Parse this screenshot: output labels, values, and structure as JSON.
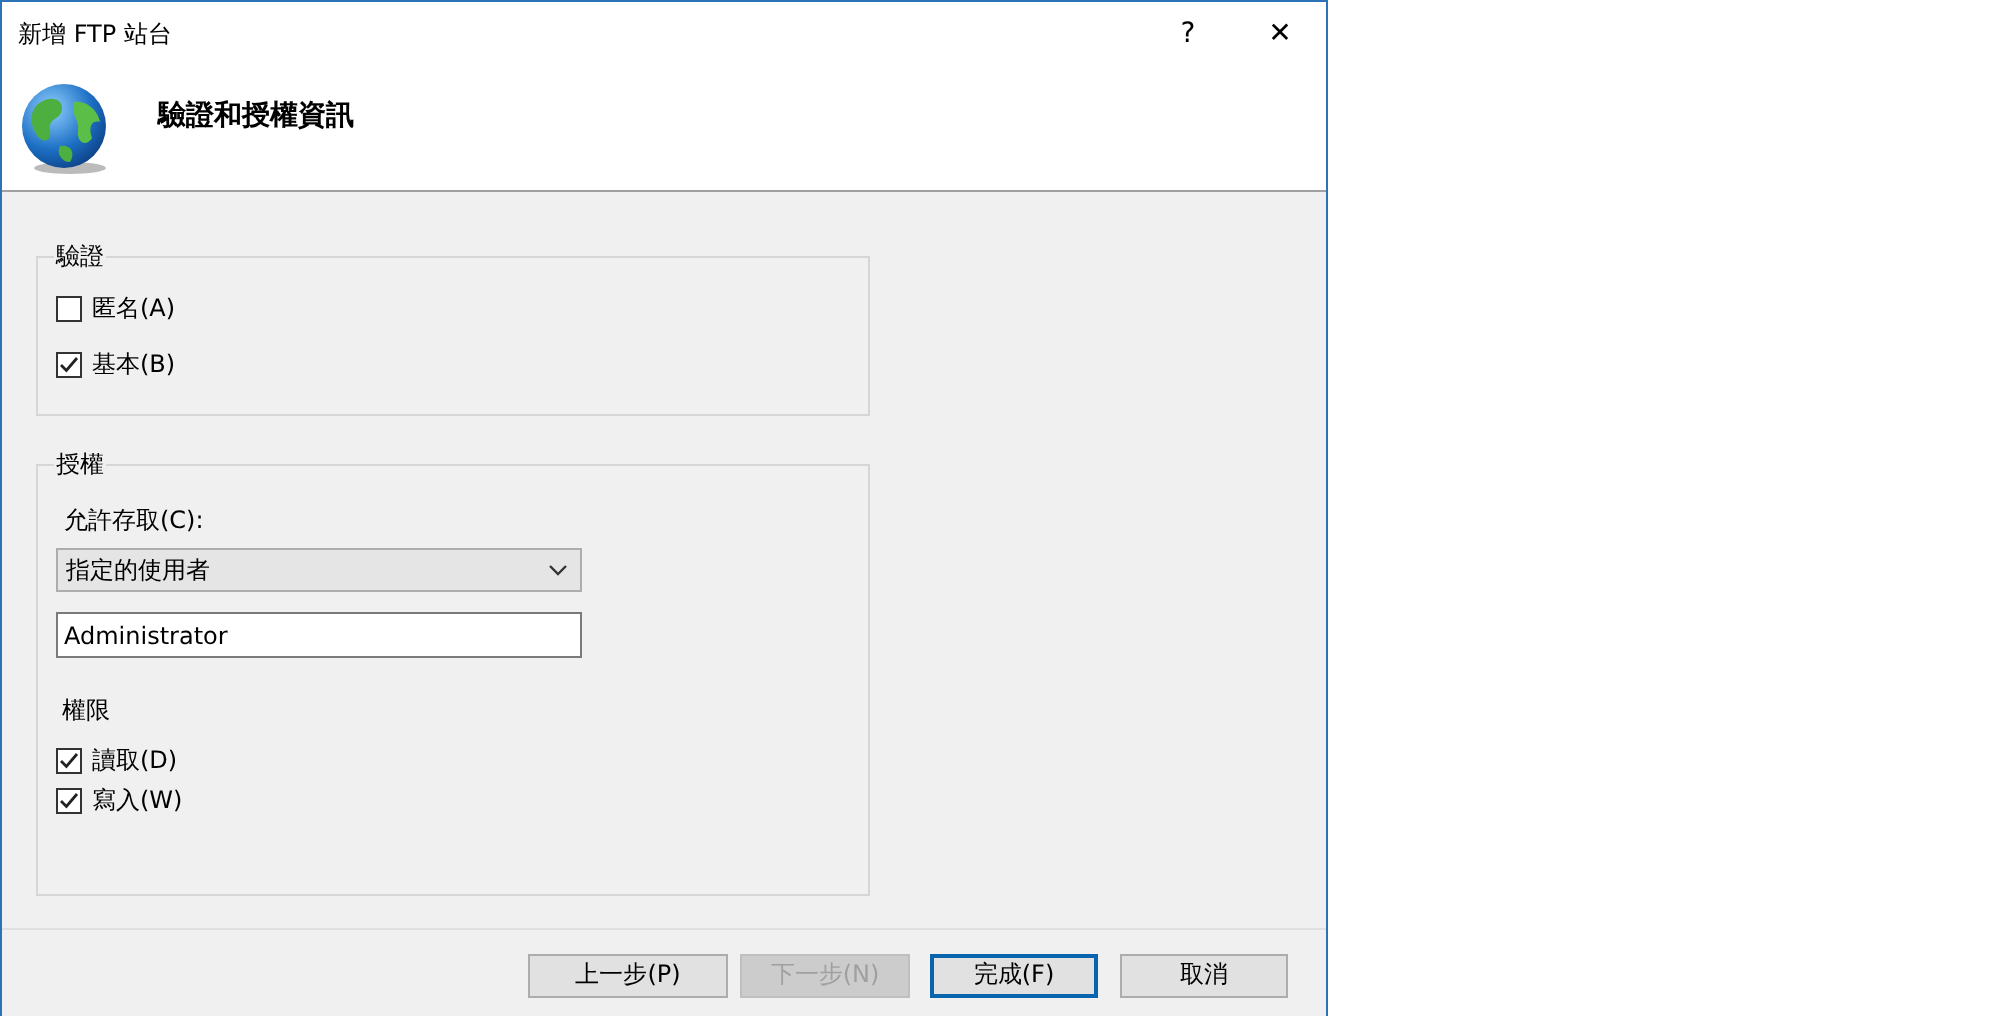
{
  "window": {
    "title": "新增 FTP 站台",
    "help": "?",
    "close": "✕"
  },
  "header": {
    "title": "驗證和授權資訊"
  },
  "authentication": {
    "legend": "驗證",
    "options": [
      {
        "label": "匿名(A)",
        "checked": false
      },
      {
        "label": "基本(B)",
        "checked": true
      }
    ]
  },
  "authorization": {
    "legend": "授權",
    "access_label": "允許存取(C):",
    "access_value": "指定的使用者",
    "user": "Administrator",
    "permissions_label": "權限",
    "permissions": [
      {
        "label": "讀取(D)",
        "checked": true
      },
      {
        "label": "寫入(W)",
        "checked": true
      }
    ]
  },
  "buttons": [
    {
      "label": "上一步(P)",
      "disabled": false,
      "default": false
    },
    {
      "label": "下一步(N)",
      "disabled": true,
      "default": false
    },
    {
      "label": "完成(F)",
      "disabled": false,
      "default": true
    },
    {
      "label": "取消",
      "disabled": false,
      "default": false
    }
  ]
}
